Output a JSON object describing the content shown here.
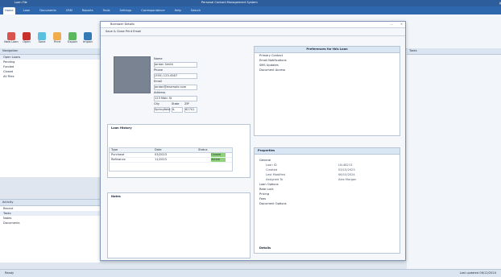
{
  "app": {
    "title": "Loan File",
    "window_title": "Personal Contact Management System",
    "window_controls": [
      "—",
      "□",
      "✕"
    ]
  },
  "ribbon": {
    "tabs": [
      "Home",
      "Loan",
      "Documents",
      "CRM",
      "Reports",
      "Tools",
      "Settings",
      "Correspondence",
      "Help",
      "Search"
    ],
    "buttons": [
      "New Loan",
      "Open",
      "Save",
      "Print",
      "Export",
      "Import"
    ]
  },
  "left_panel": {
    "title": "Navigation",
    "items": [
      "Open Loans",
      "Pending",
      "Funded",
      "Closed",
      "All Files"
    ]
  },
  "bottom_left": {
    "title": "Activity",
    "items": [
      "Recent",
      "Tasks",
      "Notes",
      "Documents"
    ]
  },
  "status": {
    "left": "Ready",
    "right": "Last updated 06/12/2024"
  },
  "dialog": {
    "title": "Borrower Details",
    "toolbar": "Save & Close  Print  Email",
    "name_label": "Name",
    "name_value": "Jordan Smith",
    "phone_label": "Phone",
    "phone_value": "(555) 123-4567",
    "email_label": "Email",
    "email_value": "jordan@example.com",
    "address_label": "Address",
    "address_value": "123 Main St",
    "city_label": "City",
    "city_value": "Springfield",
    "state_label": "State",
    "state_value": "IL",
    "zip_label": "ZIP",
    "zip_value": "62701",
    "grid_title": "Loan History",
    "grid_headers": [
      "Type",
      "Date",
      "Status"
    ],
    "grid_rows": [
      [
        "Purchase",
        "03/2023",
        "Closed"
      ],
      [
        "Refinance",
        "11/2023",
        "Active"
      ]
    ],
    "notes_title": "Notes",
    "right_title": "Preferences for this Loan",
    "right_rows": [
      "Primary Contact",
      "Email Notifications",
      "SMS Updates",
      "Document Access"
    ],
    "props_title": "Properties",
    "props_tree": [
      {
        "label": "General",
        "value": "",
        "sub": false
      },
      {
        "label": "Loan ID",
        "value": "LN-48213",
        "sub": true
      },
      {
        "label": "Created",
        "value": "03/15/2023",
        "sub": true
      },
      {
        "label": "Last Modified",
        "value": "06/10/2024",
        "sub": true
      },
      {
        "label": "Assigned To",
        "value": "Alex Morgan",
        "sub": true
      },
      {
        "label": "Loan Options",
        "value": "",
        "sub": false
      },
      {
        "label": "Rate Lock",
        "value": "",
        "sub": false
      },
      {
        "label": "Pricing",
        "value": "",
        "sub": false
      },
      {
        "label": "Fees",
        "value": "",
        "sub": false
      },
      {
        "label": "Document Options",
        "value": "",
        "sub": false
      }
    ],
    "props_footer": "Details"
  },
  "right_pane": {
    "title": "Tasks"
  },
  "colors": {
    "accent": "#2e67ad",
    "titlebar": "#2d5d9b",
    "green": "#8fd27a"
  }
}
